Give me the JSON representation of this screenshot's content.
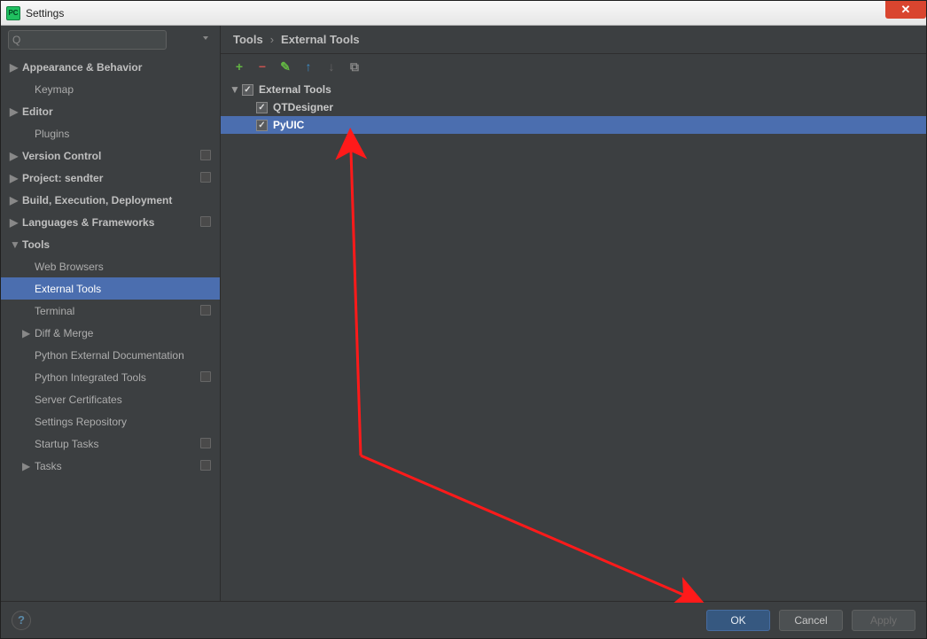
{
  "window": {
    "title": "Settings",
    "app_icon_label": "PC"
  },
  "search": {
    "placeholder": ""
  },
  "sidebar": {
    "items": [
      {
        "label": "Appearance & Behavior",
        "bold": true,
        "arrow": "▶",
        "level": 1
      },
      {
        "label": "Keymap",
        "bold": false,
        "arrow": "",
        "level": 2
      },
      {
        "label": "Editor",
        "bold": true,
        "arrow": "▶",
        "level": 1
      },
      {
        "label": "Plugins",
        "bold": false,
        "arrow": "",
        "level": 2
      },
      {
        "label": "Version Control",
        "bold": true,
        "arrow": "▶",
        "level": 1,
        "badge": true
      },
      {
        "label": "Project: sendter",
        "bold": true,
        "arrow": "▶",
        "level": 1,
        "badge": true
      },
      {
        "label": "Build, Execution, Deployment",
        "bold": true,
        "arrow": "▶",
        "level": 1
      },
      {
        "label": "Languages & Frameworks",
        "bold": true,
        "arrow": "▶",
        "level": 1,
        "badge": true
      },
      {
        "label": "Tools",
        "bold": true,
        "arrow": "▼",
        "level": 1
      },
      {
        "label": "Web Browsers",
        "bold": false,
        "arrow": "",
        "level": 2
      },
      {
        "label": "External Tools",
        "bold": false,
        "arrow": "",
        "level": 2,
        "selected": true
      },
      {
        "label": "Terminal",
        "bold": false,
        "arrow": "",
        "level": 2,
        "badge": true
      },
      {
        "label": "Diff & Merge",
        "bold": false,
        "arrow": "▶",
        "level": "2a"
      },
      {
        "label": "Python External Documentation",
        "bold": false,
        "arrow": "",
        "level": 2
      },
      {
        "label": "Python Integrated Tools",
        "bold": false,
        "arrow": "",
        "level": 2,
        "badge": true
      },
      {
        "label": "Server Certificates",
        "bold": false,
        "arrow": "",
        "level": 2
      },
      {
        "label": "Settings Repository",
        "bold": false,
        "arrow": "",
        "level": 2
      },
      {
        "label": "Startup Tasks",
        "bold": false,
        "arrow": "",
        "level": 2,
        "badge": true
      },
      {
        "label": "Tasks",
        "bold": false,
        "arrow": "▶",
        "level": "2a",
        "badge": true
      }
    ]
  },
  "breadcrumb": {
    "root": "Tools",
    "sep": "›",
    "current": "External Tools"
  },
  "toolbar": {
    "add": "+",
    "remove": "−",
    "edit": "✎",
    "up": "↑",
    "down": "↓",
    "copy": "⧉"
  },
  "content": {
    "group": {
      "label": "External Tools",
      "checked": true
    },
    "items": [
      {
        "label": "QTDesigner",
        "checked": true,
        "selected": false
      },
      {
        "label": "PyUIC",
        "checked": true,
        "selected": true
      }
    ]
  },
  "buttons": {
    "help": "?",
    "ok": "OK",
    "cancel": "Cancel",
    "apply": "Apply"
  }
}
